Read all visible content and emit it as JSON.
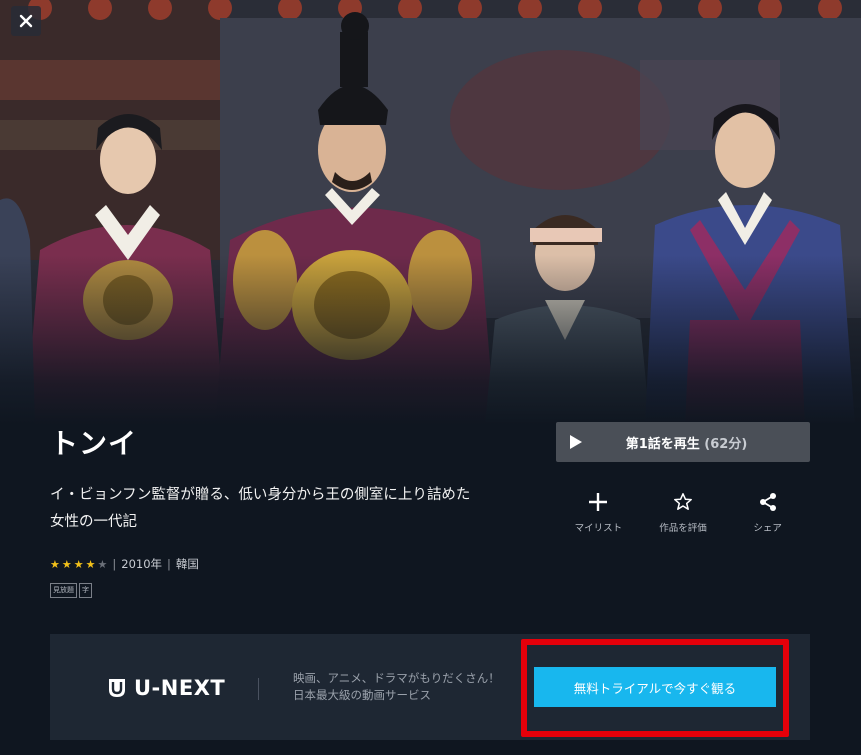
{
  "header": {
    "close_icon": "close-icon"
  },
  "show": {
    "title": "トンイ",
    "description": "イ・ビョンフン監督が贈る、低い身分から王の側室に上り詰めた女性の一代記",
    "rating": 4,
    "rating_max": 5,
    "year": "2010年",
    "country": "韓国",
    "badges": [
      "見放題",
      "字"
    ]
  },
  "play": {
    "label": "第1話を再生",
    "duration": "(62分)",
    "icon": "play-icon"
  },
  "actions": [
    {
      "label": "マイリスト",
      "icon": "plus-icon"
    },
    {
      "label": "作品を評価",
      "icon": "star-outline-icon"
    },
    {
      "label": "シェア",
      "icon": "share-icon"
    }
  ],
  "promo": {
    "logo_text": "U-NEXT",
    "line1": "映画、アニメ、ドラマがもりだくさん！",
    "line2": "日本最大級の動画サービス",
    "cta": "無料トライアルで今すぐ観る"
  },
  "colors": {
    "accent": "#18b7ee",
    "highlight": "#e5000a",
    "star": "#f2c11a"
  }
}
